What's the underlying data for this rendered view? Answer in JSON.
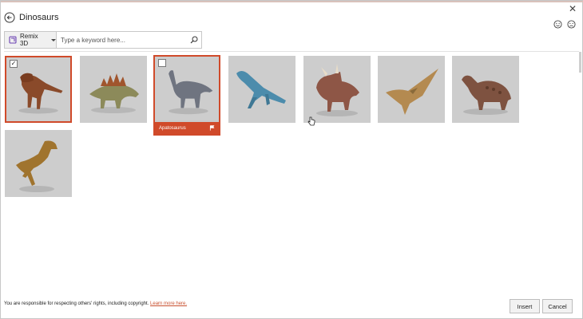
{
  "header": {
    "title": "Dinosaurs"
  },
  "search": {
    "source_label": "Remix 3D",
    "placeholder": "Type a keyword here..."
  },
  "results": [
    {
      "name": "tyrannosaurus",
      "checked": true
    },
    {
      "name": "stegosaurus",
      "checked": false
    },
    {
      "name": "apatosaurus",
      "label": "Apatosaurus",
      "checked": false
    },
    {
      "name": "plesiosaur",
      "checked": false
    },
    {
      "name": "triceratops",
      "checked": false
    },
    {
      "name": "pterodactyl",
      "checked": false
    },
    {
      "name": "ankylosaurus",
      "checked": false
    },
    {
      "name": "velociraptor",
      "checked": false
    }
  ],
  "footer": {
    "notice": "You are responsible for respecting others' rights, including copyright.",
    "learn_more": "Learn more here.",
    "insert_label": "Insert",
    "cancel_label": "Cancel"
  },
  "colors": {
    "accent": "#d04a2a",
    "tile_bg": "#c9c9c9"
  },
  "icons": [
    "back-arrow-icon",
    "close-icon",
    "smile-icon",
    "frown-icon",
    "remix3d-icon",
    "search-icon",
    "flag-icon",
    "check-icon"
  ]
}
